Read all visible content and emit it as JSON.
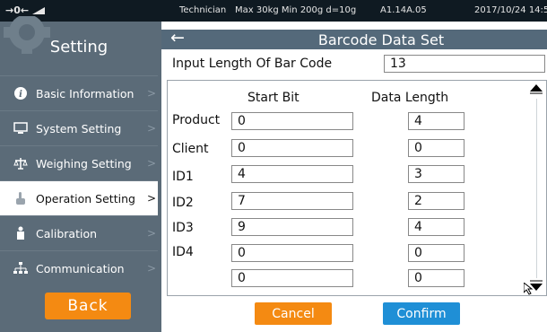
{
  "status_bar": {
    "zero_indicator": "→0←",
    "signal_icon": "balance-triangle-icon",
    "role": "Technician",
    "spec": "Max 30kg  Min 200g  d=10g",
    "version": "A1.14A.05",
    "datetime": "2017/10/24 14:5"
  },
  "sidebar": {
    "title": "Setting",
    "items": [
      {
        "label": "Basic Information",
        "icon": "info-icon",
        "active": false
      },
      {
        "label": "System Setting",
        "icon": "monitor-icon",
        "active": false
      },
      {
        "label": "Weighing Setting",
        "icon": "scale-icon",
        "active": false
      },
      {
        "label": "Operation Setting",
        "icon": "hand-pointer-icon",
        "active": true
      },
      {
        "label": "Calibration",
        "icon": "weight-icon",
        "active": false
      },
      {
        "label": "Communication",
        "icon": "network-icon",
        "active": false
      }
    ],
    "chevron": ">",
    "back_label": "Back"
  },
  "header": {
    "back_arrow": "←",
    "title": "Barcode Data Set"
  },
  "length_row": {
    "label": "Input Length Of  Bar Code",
    "value": "13"
  },
  "table": {
    "columns": [
      "Start Bit",
      "Data Length"
    ],
    "rows": [
      {
        "label": "Product",
        "start": "0",
        "length": "4"
      },
      {
        "label": "Client",
        "start": "0",
        "length": "0"
      },
      {
        "label": "ID1",
        "start": "4",
        "length": "3"
      },
      {
        "label": "ID2",
        "start": "7",
        "length": "2"
      },
      {
        "label": "ID3",
        "start": "9",
        "length": "4"
      },
      {
        "label": "ID4",
        "start": "0",
        "length": "0"
      },
      {
        "label": "",
        "start": "0",
        "length": "0"
      }
    ]
  },
  "buttons": {
    "cancel": "Cancel",
    "confirm": "Confirm"
  },
  "colors": {
    "accent_orange": "#f48a12",
    "accent_blue": "#1f8fd6",
    "header_slate": "#54697a",
    "sidebar_slate": "#5b6b78"
  }
}
